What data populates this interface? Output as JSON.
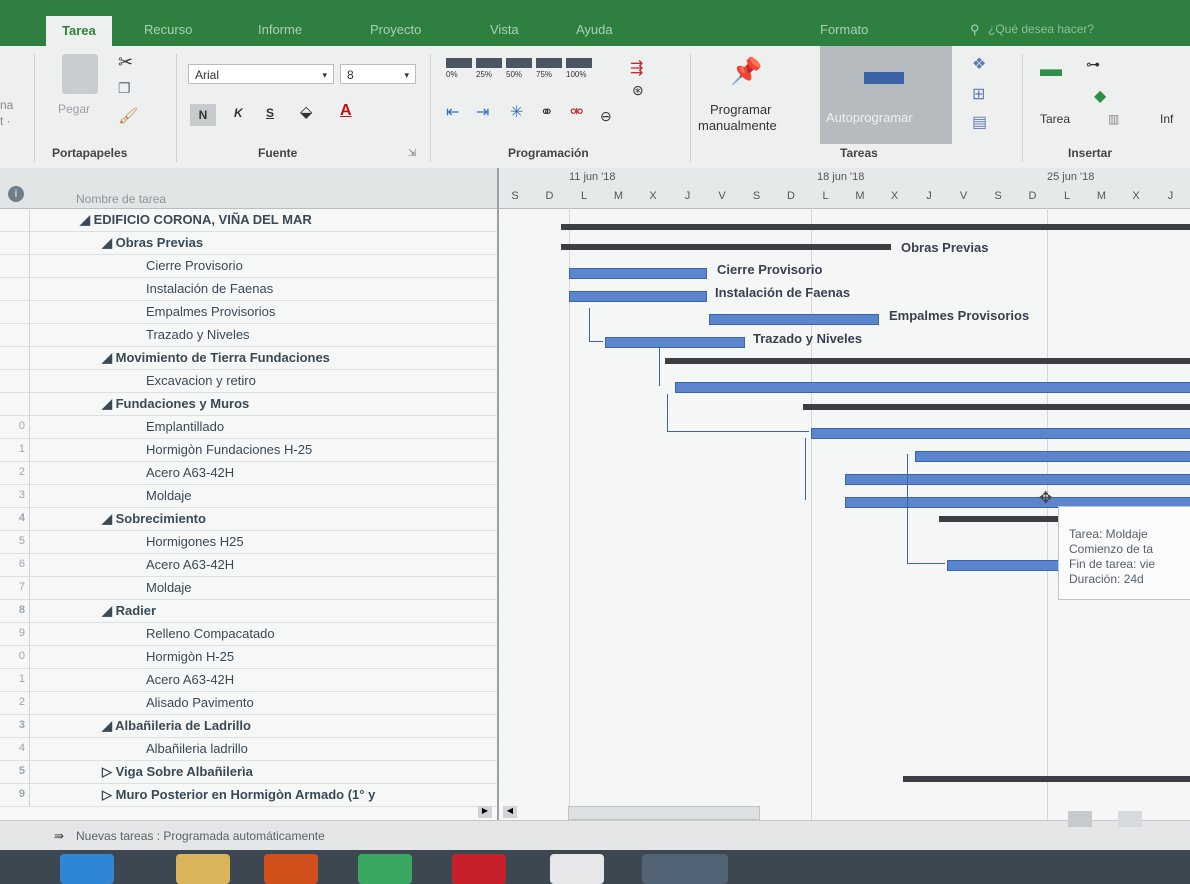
{
  "tabs": [
    "Tarea",
    "Recurso",
    "Informe",
    "Proyecto",
    "Vista",
    "Ayuda",
    "Formato"
  ],
  "active_tab": "Tarea",
  "tell_me": "¿Qué desea hacer?",
  "ribbon": {
    "left_cut_label_1": "na",
    "left_cut_label_2": "t ·",
    "paste_label": "Pegar",
    "clipboard_group": "Portapapeles",
    "font_name": "Arial",
    "font_size": "8",
    "bold": "N",
    "italic": "K",
    "underline": "S",
    "font_group": "Fuente",
    "pct_buttons": [
      "0%",
      "25%",
      "50%",
      "75%",
      "100%"
    ],
    "schedule_group": "Programación",
    "manual_label_1": "Programar",
    "manual_label_2": "manualmente",
    "auto_label": "Autoprogramar",
    "tasks_group": "Tareas",
    "task_btn": "Tarea",
    "insert_group": "Insertar",
    "cut_right": "Inf"
  },
  "table": {
    "header": "Nombre de tarea",
    "rows": [
      {
        "num": "",
        "name": "◢ EDIFICIO CORONA, VIÑA DEL MAR",
        "level": 0,
        "summary": true
      },
      {
        "num": "",
        "name": "◢ Obras Previas",
        "level": 1,
        "summary": true
      },
      {
        "num": "",
        "name": "Cierre Provisorio",
        "level": 2,
        "summary": false
      },
      {
        "num": "",
        "name": "Instalación de Faenas",
        "level": 2,
        "summary": false
      },
      {
        "num": "",
        "name": "Empalmes Provisorios",
        "level": 2,
        "summary": false
      },
      {
        "num": "",
        "name": "Trazado y Niveles",
        "level": 2,
        "summary": false
      },
      {
        "num": "",
        "name": "◢ Movimiento de Tierra Fundaciones",
        "level": 1,
        "summary": true
      },
      {
        "num": "",
        "name": "Excavacion y retiro",
        "level": 2,
        "summary": false
      },
      {
        "num": "",
        "name": "◢ Fundaciones y Muros",
        "level": 1,
        "summary": true
      },
      {
        "num": "0",
        "name": "Emplantillado",
        "level": 2,
        "summary": false
      },
      {
        "num": "1",
        "name": "Hormigòn Fundaciones H-25",
        "level": 2,
        "summary": false
      },
      {
        "num": "2",
        "name": "Acero A63-42H",
        "level": 2,
        "summary": false
      },
      {
        "num": "3",
        "name": "Moldaje",
        "level": 2,
        "summary": false
      },
      {
        "num": "4",
        "name": "◢ Sobrecimiento",
        "level": 1,
        "summary": true
      },
      {
        "num": "5",
        "name": "Hormigones H25",
        "level": 2,
        "summary": false
      },
      {
        "num": "6",
        "name": "Acero A63-42H",
        "level": 2,
        "summary": false
      },
      {
        "num": "7",
        "name": "Moldaje",
        "level": 2,
        "summary": false
      },
      {
        "num": "8",
        "name": "◢ Radier",
        "level": 1,
        "summary": true
      },
      {
        "num": "9",
        "name": "Relleno Compacatado",
        "level": 2,
        "summary": false
      },
      {
        "num": "0",
        "name": "Hormigòn H-25",
        "level": 2,
        "summary": false
      },
      {
        "num": "1",
        "name": "Acero A63-42H",
        "level": 2,
        "summary": false
      },
      {
        "num": "2",
        "name": "Alisado Pavimento",
        "level": 2,
        "summary": false
      },
      {
        "num": "3",
        "name": "◢ Albañileria de Ladrillo",
        "level": 1,
        "summary": true
      },
      {
        "num": "4",
        "name": "Albañileria ladrillo",
        "level": 2,
        "summary": false
      },
      {
        "num": "5",
        "name": "▷ Viga Sobre Albañilerìa",
        "level": 1,
        "summary": true
      },
      {
        "num": "9",
        "name": "▷ Muro Posterior en Hormigòn Armado (1° y",
        "level": 1,
        "summary": true
      }
    ]
  },
  "gantt": {
    "weeks": [
      "11 jun '18",
      "18 jun '18",
      "25 jun '18"
    ],
    "days": [
      "S",
      "D",
      "L",
      "M",
      "X",
      "J",
      "V",
      "S",
      "D",
      "L",
      "M",
      "X",
      "J",
      "V",
      "S",
      "D",
      "L",
      "M",
      "X",
      "J"
    ],
    "labels": [
      "Obras Previas",
      "Cierre Provisorio",
      "Instalación de Faenas",
      "Empalmes Provisorios",
      "Trazado y Niveles"
    ],
    "tooltip": [
      "Tarea: Moldaje",
      "Comienzo de ta",
      "Fin de tarea: vie",
      "Duración: 24d"
    ]
  },
  "status": "Nuevas tareas : Programada automáticamente"
}
